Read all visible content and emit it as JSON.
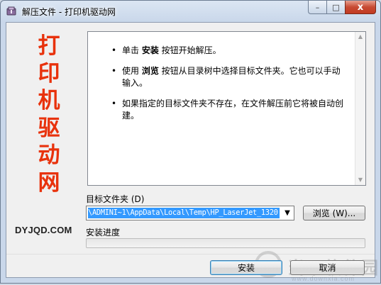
{
  "window": {
    "title": "解压文件 - 打印机驱动网",
    "controls": {
      "minimize": "–",
      "maximize": "□",
      "close": "x"
    }
  },
  "brand": {
    "chars": [
      "打",
      "印",
      "机",
      "驱",
      "动",
      "网"
    ],
    "domain": "DYJQD.COM",
    "color": "#e8320c"
  },
  "instructions": {
    "bullet": "•",
    "items": [
      {
        "pre": "单击 ",
        "keyword": "安装",
        "post": " 按钮开始解压。"
      },
      {
        "pre": "使用 ",
        "keyword": "浏览",
        "post": " 按钮从目录树中选择目标文件夹。它也可以手动输入。"
      },
      {
        "pre": "",
        "keyword": "",
        "post": "如果指定的目标文件夹不存在，在文件解压前它将被自动创建。"
      }
    ]
  },
  "destination": {
    "label": "目标文件夹 (D)",
    "path": "\\ADMINI~1\\AppData\\Local\\Temp\\HP_LaserJet_1320",
    "browse_label": "浏览 (W)..."
  },
  "progress": {
    "label": "安装进度",
    "percent": 0
  },
  "buttons": {
    "install": "安装",
    "cancel": "取消"
  },
  "watermark": {
    "text": "当下软件园",
    "sub": "www.downxia.com"
  }
}
